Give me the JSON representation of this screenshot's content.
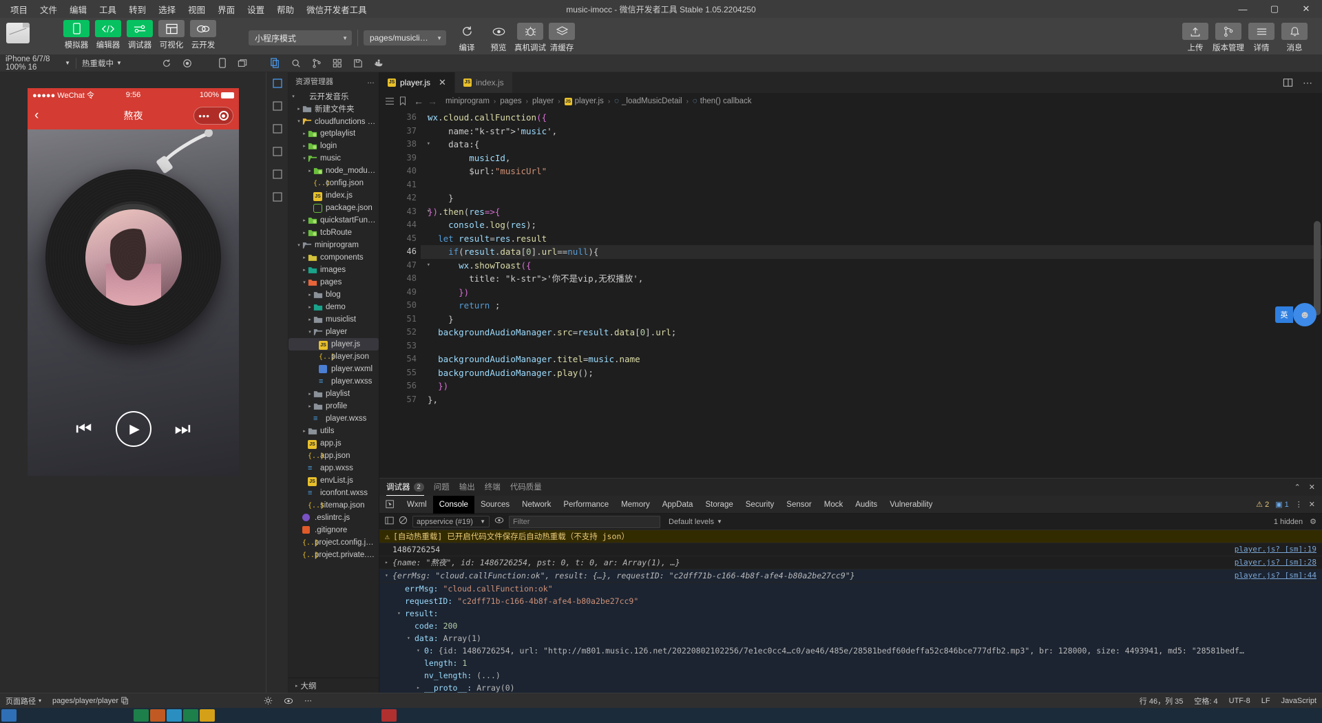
{
  "window": {
    "title": "music-imocc - 微信开发者工具 Stable 1.05.2204250",
    "minimize": "—",
    "maximize": "▢",
    "close": "✕"
  },
  "menubar": [
    "项目",
    "文件",
    "编辑",
    "工具",
    "转到",
    "选择",
    "视图",
    "界面",
    "设置",
    "帮助",
    "微信开发者工具"
  ],
  "toolbar": {
    "mode_buttons": [
      {
        "label": "模拟器",
        "icon": "phone-icon",
        "style": "green"
      },
      {
        "label": "编辑器",
        "icon": "code-icon",
        "style": "green"
      },
      {
        "label": "调试器",
        "icon": "sliders-icon",
        "style": "green"
      },
      {
        "label": "可视化",
        "icon": "layout-icon",
        "style": "grey"
      },
      {
        "label": "云开发",
        "icon": "cloud-icon",
        "style": "grey"
      }
    ],
    "mode_select": "小程序模式",
    "page_select": "pages/musiclist/musi...",
    "actions": [
      {
        "label": "编译",
        "icon": "refresh-icon"
      },
      {
        "label": "预览",
        "icon": "eye-icon"
      },
      {
        "label": "真机调试",
        "icon": "bug-icon"
      },
      {
        "label": "清缓存",
        "icon": "stack-icon"
      }
    ],
    "right_actions": [
      {
        "label": "上传",
        "icon": "upload-icon"
      },
      {
        "label": "版本管理",
        "icon": "branch-icon"
      },
      {
        "label": "详情",
        "icon": "menu-icon"
      },
      {
        "label": "消息",
        "icon": "bell-icon"
      }
    ]
  },
  "subbar": {
    "device": "iPhone 6/7/8 100% 16",
    "device_caret": "▾",
    "hotreload": "热重载中",
    "hotreload_caret": "▾",
    "sim_icons": [
      "rotate-icon",
      "record-icon",
      "phone-small-icon",
      "window-icon"
    ],
    "explorer_icons": [
      "files-icon",
      "search-icon",
      "source-control-icon",
      "extensions-icon",
      "save-icon",
      "docker-icon"
    ],
    "more": "…"
  },
  "simulator": {
    "status": {
      "carrier": "●●●●● WeChat 令",
      "time": "9:56",
      "battery": "100%"
    },
    "nav": {
      "back": "‹",
      "title": "熬夜",
      "dots": "•••",
      "target": "◉"
    },
    "controls": {
      "prev": "⏮",
      "play": "▶",
      "next": "⏭"
    }
  },
  "explorer": {
    "title": "资源管理器",
    "more": "…",
    "outline": "大纲",
    "tree": [
      {
        "depth": 0,
        "arrow": "▾",
        "label": "云开发音乐",
        "icon": "root",
        "sel": false
      },
      {
        "depth": 1,
        "arrow": "▸",
        "label": "新建文件夹",
        "icon": "folder-grey",
        "sel": false
      },
      {
        "depth": 1,
        "arrow": "▾",
        "label": "cloudfunctions | 当前...",
        "icon": "folder-open-yellow",
        "sel": false
      },
      {
        "depth": 2,
        "arrow": "▸",
        "label": "getplaylist",
        "icon": "folder-green",
        "sel": false
      },
      {
        "depth": 2,
        "arrow": "▸",
        "label": "login",
        "icon": "folder-green",
        "sel": false
      },
      {
        "depth": 2,
        "arrow": "▾",
        "label": "music",
        "icon": "folder-green-open",
        "sel": false
      },
      {
        "depth": 3,
        "arrow": "▸",
        "label": "node_modules",
        "icon": "folder-green",
        "sel": false
      },
      {
        "depth": 3,
        "arrow": "none",
        "label": "config.json",
        "icon": "json",
        "sel": false
      },
      {
        "depth": 3,
        "arrow": "none",
        "label": "index.js",
        "icon": "js",
        "sel": false
      },
      {
        "depth": 3,
        "arrow": "none",
        "label": "package.json",
        "icon": "node",
        "sel": false
      },
      {
        "depth": 2,
        "arrow": "▸",
        "label": "quickstartFunctions",
        "icon": "folder-green",
        "sel": false
      },
      {
        "depth": 2,
        "arrow": "▸",
        "label": "tcbRoute",
        "icon": "folder-green",
        "sel": false
      },
      {
        "depth": 1,
        "arrow": "▾",
        "label": "miniprogram",
        "icon": "folder-open-grey",
        "sel": false
      },
      {
        "depth": 2,
        "arrow": "▸",
        "label": "components",
        "icon": "folder-yellow",
        "sel": false
      },
      {
        "depth": 2,
        "arrow": "▸",
        "label": "images",
        "icon": "folder-teal",
        "sel": false
      },
      {
        "depth": 2,
        "arrow": "▾",
        "label": "pages",
        "icon": "folder-orange",
        "sel": false
      },
      {
        "depth": 3,
        "arrow": "▸",
        "label": "blog",
        "icon": "folder-grey",
        "sel": false
      },
      {
        "depth": 3,
        "arrow": "▸",
        "label": "demo",
        "icon": "folder-teal",
        "sel": false
      },
      {
        "depth": 3,
        "arrow": "▸",
        "label": "musiclist",
        "icon": "folder-grey",
        "sel": false
      },
      {
        "depth": 3,
        "arrow": "▾",
        "label": "player",
        "icon": "folder-open-grey",
        "sel": false
      },
      {
        "depth": 4,
        "arrow": "none",
        "label": "player.js",
        "icon": "js",
        "sel": true
      },
      {
        "depth": 4,
        "arrow": "none",
        "label": "player.json",
        "icon": "json",
        "sel": false
      },
      {
        "depth": 4,
        "arrow": "none",
        "label": "player.wxml",
        "icon": "wxml",
        "sel": false
      },
      {
        "depth": 4,
        "arrow": "none",
        "label": "player.wxss",
        "icon": "wxss",
        "sel": false
      },
      {
        "depth": 3,
        "arrow": "▸",
        "label": "playlist",
        "icon": "folder-grey",
        "sel": false
      },
      {
        "depth": 3,
        "arrow": "▸",
        "label": "profile",
        "icon": "folder-grey",
        "sel": false
      },
      {
        "depth": 3,
        "arrow": "none",
        "label": "player.wxss",
        "icon": "wxss",
        "sel": false
      },
      {
        "depth": 2,
        "arrow": "▸",
        "label": "utils",
        "icon": "folder-grey",
        "sel": false
      },
      {
        "depth": 2,
        "arrow": "none",
        "label": "app.js",
        "icon": "js",
        "sel": false
      },
      {
        "depth": 2,
        "arrow": "none",
        "label": "app.json",
        "icon": "json",
        "sel": false
      },
      {
        "depth": 2,
        "arrow": "none",
        "label": "app.wxss",
        "icon": "wxss",
        "sel": false
      },
      {
        "depth": 2,
        "arrow": "none",
        "label": "envList.js",
        "icon": "js",
        "sel": false
      },
      {
        "depth": 2,
        "arrow": "none",
        "label": "iconfont.wxss",
        "icon": "wxss",
        "sel": false
      },
      {
        "depth": 2,
        "arrow": "none",
        "label": "sitemap.json",
        "icon": "json",
        "sel": false
      },
      {
        "depth": 1,
        "arrow": "none",
        "label": ".eslintrc.js",
        "icon": "eslint",
        "sel": false
      },
      {
        "depth": 1,
        "arrow": "none",
        "label": ".gitignore",
        "icon": "git",
        "sel": false
      },
      {
        "depth": 1,
        "arrow": "none",
        "label": "project.config.json",
        "icon": "json",
        "sel": false
      },
      {
        "depth": 1,
        "arrow": "none",
        "label": "project.private.config.js...",
        "icon": "json",
        "sel": false
      }
    ]
  },
  "editor": {
    "tabs": [
      {
        "label": "index.js",
        "icon": "js",
        "active": false,
        "closable": false
      },
      {
        "label": "player.js",
        "icon": "js",
        "active": true,
        "closable": true,
        "close": "✕"
      }
    ],
    "breadcrumb": [
      "miniprogram",
      "pages",
      "player",
      "player.js",
      "_loadMusicDetail",
      "then() callback"
    ],
    "breadcrumb_sep": "›",
    "first_line": 36,
    "current_line": 46,
    "lines": [
      {
        "n": 36,
        "fold": "▾",
        "text": "wx.cloud.callFunction({"
      },
      {
        "n": 37,
        "fold": "",
        "text": "    name:'music',"
      },
      {
        "n": 38,
        "fold": "▾",
        "text": "    data:{"
      },
      {
        "n": 39,
        "fold": "",
        "text": "        musicId,"
      },
      {
        "n": 40,
        "fold": "",
        "text": "        $url:\"musicUrl\""
      },
      {
        "n": 41,
        "fold": "",
        "text": ""
      },
      {
        "n": 42,
        "fold": "",
        "text": "    }"
      },
      {
        "n": 43,
        "fold": "▾",
        "text": "}).then(res=>{"
      },
      {
        "n": 44,
        "fold": "",
        "text": "    console.log(res);"
      },
      {
        "n": 45,
        "fold": "",
        "text": "  let result=res.result"
      },
      {
        "n": 46,
        "fold": "▾",
        "text": "    if(result.data[0].url==null){"
      },
      {
        "n": 47,
        "fold": "▾",
        "text": "      wx.showToast({"
      },
      {
        "n": 48,
        "fold": "",
        "text": "        title: '你不是vip,无权播放',"
      },
      {
        "n": 49,
        "fold": "",
        "text": "      })"
      },
      {
        "n": 50,
        "fold": "",
        "text": "      return ;"
      },
      {
        "n": 51,
        "fold": "",
        "text": "    }"
      },
      {
        "n": 52,
        "fold": "",
        "text": "  backgroundAudioManager.src=result.data[0].url;"
      },
      {
        "n": 53,
        "fold": "",
        "text": ""
      },
      {
        "n": 54,
        "fold": "",
        "text": "  backgroundAudioManager.titel=music.name"
      },
      {
        "n": 55,
        "fold": "",
        "text": "  backgroundAudioManager.play();"
      },
      {
        "n": 56,
        "fold": "",
        "text": "  })"
      },
      {
        "n": 57,
        "fold": "",
        "text": "},"
      }
    ]
  },
  "debugger": {
    "tabs": [
      {
        "label": "调试器",
        "badge": "2",
        "active": true
      },
      {
        "label": "问题",
        "badge": "",
        "active": false
      },
      {
        "label": "输出",
        "badge": "",
        "active": false
      },
      {
        "label": "终端",
        "badge": "",
        "active": false
      },
      {
        "label": "代码质量",
        "badge": "",
        "active": false
      }
    ],
    "collapse": "⌃",
    "close": "✕",
    "devtools_tabs": [
      "Wxml",
      "Console",
      "Sources",
      "Network",
      "Performance",
      "Memory",
      "AppData",
      "Storage",
      "Security",
      "Sensor",
      "Mock",
      "Audits",
      "Vulnerability"
    ],
    "devtools_active": "Console",
    "warn_count": "2",
    "info_count": "1",
    "console": {
      "context": "appservice (#19)",
      "context_caret": "▾",
      "filter_placeholder": "Filter",
      "levels": "Default levels",
      "levels_caret": "▾",
      "hidden": "1 hidden",
      "rows": [
        {
          "type": "warn",
          "icon": "warning-icon",
          "text": "[自动热重载] 已开启代码文件保存后自动热重载（不支持 json）",
          "src": ""
        },
        {
          "type": "plain",
          "text": "1486726254",
          "src": "player.js? [sm]:19"
        },
        {
          "type": "obj",
          "tri": "▸",
          "text": "{name: \"熬夜\", id: 1486726254, pst: 0, t: 0, ar: Array(1), …}",
          "src": "player.js? [sm]:28"
        },
        {
          "type": "obj-expanded",
          "tri": "▾",
          "text": "{errMsg: \"cloud.callFunction:ok\", result: {…}, requestID: \"c2dff71b-c166-4b8f-afe4-b80a2be27cc9\"}",
          "src": "player.js? [sm]:44"
        }
      ],
      "detail": [
        {
          "indent": 1,
          "tri": "",
          "key": "errMsg:",
          "val": "\"cloud.callFunction:ok\"",
          "valtype": "str"
        },
        {
          "indent": 1,
          "tri": "",
          "key": "requestID:",
          "val": "\"c2dff71b-c166-4b8f-afe4-b80a2be27cc9\"",
          "valtype": "str"
        },
        {
          "indent": 1,
          "tri": "▾",
          "key": "result:",
          "val": "",
          "valtype": "none"
        },
        {
          "indent": 2,
          "tri": "",
          "key": "code:",
          "val": "200",
          "valtype": "num"
        },
        {
          "indent": 2,
          "tri": "▾",
          "key": "data:",
          "val": "Array(1)",
          "valtype": "plain"
        },
        {
          "indent": 3,
          "tri": "▾",
          "key": "0:",
          "val": "{id: 1486726254, url: \"http://m801.music.126.net/20220802102256/7e1ec0cc4…c0/ae46/485e/28581bedf60deffa52c846bce777dfb2.mp3\", br: 128000, size: 4493941, md5: \"28581bedf…",
          "valtype": "obj"
        },
        {
          "indent": 3,
          "tri": "",
          "key": "length:",
          "val": "1",
          "valtype": "num"
        },
        {
          "indent": 3,
          "tri": "",
          "key": "nv_length:",
          "val": "(...)",
          "valtype": "plain"
        },
        {
          "indent": 3,
          "tri": "▸",
          "key": "__proto__:",
          "val": "Array(0)",
          "valtype": "plain"
        },
        {
          "indent": 2,
          "tri": "▸",
          "key": "__proto__:",
          "val": "Object",
          "valtype": "plain"
        },
        {
          "indent": 1,
          "tri": "▸",
          "key": "__proto__:",
          "val": "Object",
          "valtype": "plain"
        }
      ]
    }
  },
  "statusbar": {
    "left": [
      {
        "label": "页面路径",
        "icon": "",
        "caret": "▾"
      },
      {
        "label": "pages/player/player",
        "icon": "copy-icon",
        "caret": ""
      }
    ],
    "mid_icons": [
      "settings-icon",
      "eye-icon",
      "more-icon"
    ],
    "right": [
      {
        "label": "行 46，列 35"
      },
      {
        "label": "空格: 4"
      },
      {
        "label": "UTF-8"
      },
      {
        "label": "LF"
      },
      {
        "label": "JavaScript"
      }
    ]
  },
  "floatball": {
    "text": "英",
    "face": "☻"
  }
}
